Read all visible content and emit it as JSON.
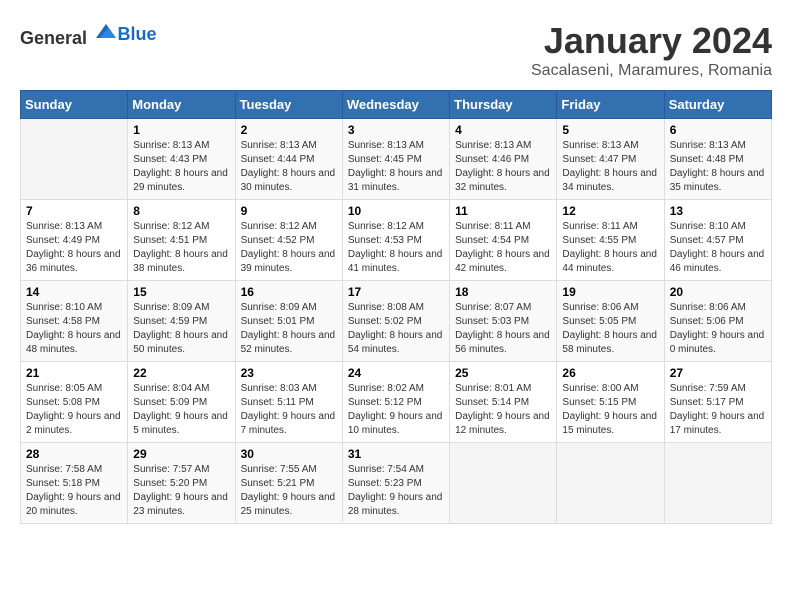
{
  "logo": {
    "general": "General",
    "blue": "Blue"
  },
  "header": {
    "month_year": "January 2024",
    "location": "Sacalaseni, Maramures, Romania"
  },
  "weekdays": [
    "Sunday",
    "Monday",
    "Tuesday",
    "Wednesday",
    "Thursday",
    "Friday",
    "Saturday"
  ],
  "weeks": [
    [
      {
        "day": "",
        "sunrise": "",
        "sunset": "",
        "daylight": ""
      },
      {
        "day": "1",
        "sunrise": "Sunrise: 8:13 AM",
        "sunset": "Sunset: 4:43 PM",
        "daylight": "Daylight: 8 hours and 29 minutes."
      },
      {
        "day": "2",
        "sunrise": "Sunrise: 8:13 AM",
        "sunset": "Sunset: 4:44 PM",
        "daylight": "Daylight: 8 hours and 30 minutes."
      },
      {
        "day": "3",
        "sunrise": "Sunrise: 8:13 AM",
        "sunset": "Sunset: 4:45 PM",
        "daylight": "Daylight: 8 hours and 31 minutes."
      },
      {
        "day": "4",
        "sunrise": "Sunrise: 8:13 AM",
        "sunset": "Sunset: 4:46 PM",
        "daylight": "Daylight: 8 hours and 32 minutes."
      },
      {
        "day": "5",
        "sunrise": "Sunrise: 8:13 AM",
        "sunset": "Sunset: 4:47 PM",
        "daylight": "Daylight: 8 hours and 34 minutes."
      },
      {
        "day": "6",
        "sunrise": "Sunrise: 8:13 AM",
        "sunset": "Sunset: 4:48 PM",
        "daylight": "Daylight: 8 hours and 35 minutes."
      }
    ],
    [
      {
        "day": "7",
        "sunrise": "Sunrise: 8:13 AM",
        "sunset": "Sunset: 4:49 PM",
        "daylight": "Daylight: 8 hours and 36 minutes."
      },
      {
        "day": "8",
        "sunrise": "Sunrise: 8:12 AM",
        "sunset": "Sunset: 4:51 PM",
        "daylight": "Daylight: 8 hours and 38 minutes."
      },
      {
        "day": "9",
        "sunrise": "Sunrise: 8:12 AM",
        "sunset": "Sunset: 4:52 PM",
        "daylight": "Daylight: 8 hours and 39 minutes."
      },
      {
        "day": "10",
        "sunrise": "Sunrise: 8:12 AM",
        "sunset": "Sunset: 4:53 PM",
        "daylight": "Daylight: 8 hours and 41 minutes."
      },
      {
        "day": "11",
        "sunrise": "Sunrise: 8:11 AM",
        "sunset": "Sunset: 4:54 PM",
        "daylight": "Daylight: 8 hours and 42 minutes."
      },
      {
        "day": "12",
        "sunrise": "Sunrise: 8:11 AM",
        "sunset": "Sunset: 4:55 PM",
        "daylight": "Daylight: 8 hours and 44 minutes."
      },
      {
        "day": "13",
        "sunrise": "Sunrise: 8:10 AM",
        "sunset": "Sunset: 4:57 PM",
        "daylight": "Daylight: 8 hours and 46 minutes."
      }
    ],
    [
      {
        "day": "14",
        "sunrise": "Sunrise: 8:10 AM",
        "sunset": "Sunset: 4:58 PM",
        "daylight": "Daylight: 8 hours and 48 minutes."
      },
      {
        "day": "15",
        "sunrise": "Sunrise: 8:09 AM",
        "sunset": "Sunset: 4:59 PM",
        "daylight": "Daylight: 8 hours and 50 minutes."
      },
      {
        "day": "16",
        "sunrise": "Sunrise: 8:09 AM",
        "sunset": "Sunset: 5:01 PM",
        "daylight": "Daylight: 8 hours and 52 minutes."
      },
      {
        "day": "17",
        "sunrise": "Sunrise: 8:08 AM",
        "sunset": "Sunset: 5:02 PM",
        "daylight": "Daylight: 8 hours and 54 minutes."
      },
      {
        "day": "18",
        "sunrise": "Sunrise: 8:07 AM",
        "sunset": "Sunset: 5:03 PM",
        "daylight": "Daylight: 8 hours and 56 minutes."
      },
      {
        "day": "19",
        "sunrise": "Sunrise: 8:06 AM",
        "sunset": "Sunset: 5:05 PM",
        "daylight": "Daylight: 8 hours and 58 minutes."
      },
      {
        "day": "20",
        "sunrise": "Sunrise: 8:06 AM",
        "sunset": "Sunset: 5:06 PM",
        "daylight": "Daylight: 9 hours and 0 minutes."
      }
    ],
    [
      {
        "day": "21",
        "sunrise": "Sunrise: 8:05 AM",
        "sunset": "Sunset: 5:08 PM",
        "daylight": "Daylight: 9 hours and 2 minutes."
      },
      {
        "day": "22",
        "sunrise": "Sunrise: 8:04 AM",
        "sunset": "Sunset: 5:09 PM",
        "daylight": "Daylight: 9 hours and 5 minutes."
      },
      {
        "day": "23",
        "sunrise": "Sunrise: 8:03 AM",
        "sunset": "Sunset: 5:11 PM",
        "daylight": "Daylight: 9 hours and 7 minutes."
      },
      {
        "day": "24",
        "sunrise": "Sunrise: 8:02 AM",
        "sunset": "Sunset: 5:12 PM",
        "daylight": "Daylight: 9 hours and 10 minutes."
      },
      {
        "day": "25",
        "sunrise": "Sunrise: 8:01 AM",
        "sunset": "Sunset: 5:14 PM",
        "daylight": "Daylight: 9 hours and 12 minutes."
      },
      {
        "day": "26",
        "sunrise": "Sunrise: 8:00 AM",
        "sunset": "Sunset: 5:15 PM",
        "daylight": "Daylight: 9 hours and 15 minutes."
      },
      {
        "day": "27",
        "sunrise": "Sunrise: 7:59 AM",
        "sunset": "Sunset: 5:17 PM",
        "daylight": "Daylight: 9 hours and 17 minutes."
      }
    ],
    [
      {
        "day": "28",
        "sunrise": "Sunrise: 7:58 AM",
        "sunset": "Sunset: 5:18 PM",
        "daylight": "Daylight: 9 hours and 20 minutes."
      },
      {
        "day": "29",
        "sunrise": "Sunrise: 7:57 AM",
        "sunset": "Sunset: 5:20 PM",
        "daylight": "Daylight: 9 hours and 23 minutes."
      },
      {
        "day": "30",
        "sunrise": "Sunrise: 7:55 AM",
        "sunset": "Sunset: 5:21 PM",
        "daylight": "Daylight: 9 hours and 25 minutes."
      },
      {
        "day": "31",
        "sunrise": "Sunrise: 7:54 AM",
        "sunset": "Sunset: 5:23 PM",
        "daylight": "Daylight: 9 hours and 28 minutes."
      },
      {
        "day": "",
        "sunrise": "",
        "sunset": "",
        "daylight": ""
      },
      {
        "day": "",
        "sunrise": "",
        "sunset": "",
        "daylight": ""
      },
      {
        "day": "",
        "sunrise": "",
        "sunset": "",
        "daylight": ""
      }
    ]
  ]
}
